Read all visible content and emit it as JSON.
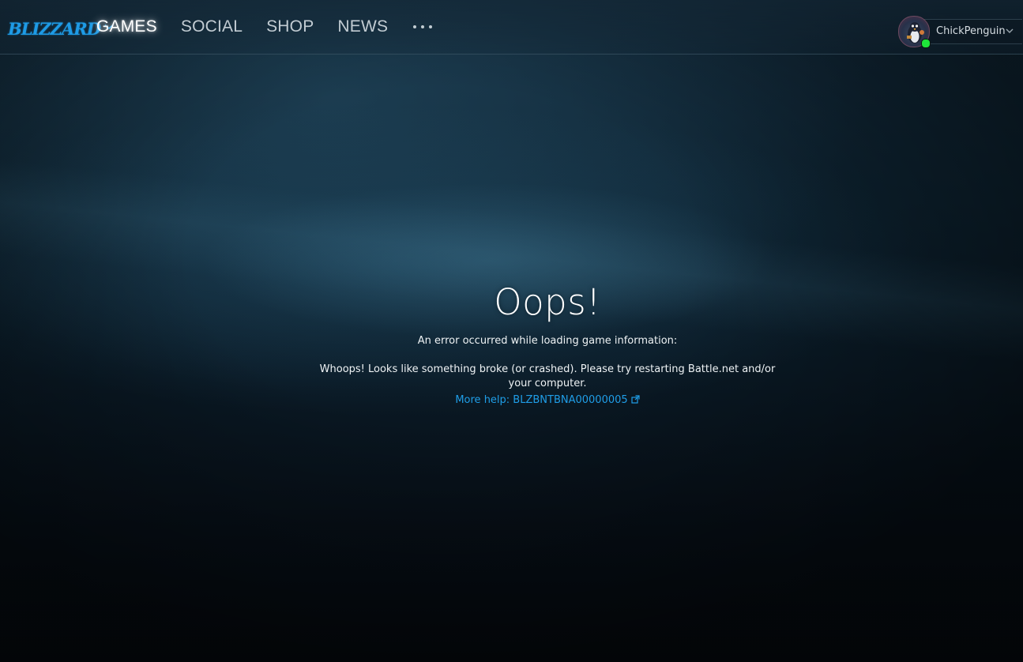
{
  "header": {
    "logo_text": "BLIZZARD",
    "nav": [
      {
        "label": "GAMES",
        "active": true
      },
      {
        "label": "SOCIAL",
        "active": false
      },
      {
        "label": "SHOP",
        "active": false
      },
      {
        "label": "NEWS",
        "active": false
      }
    ],
    "more_icon": "more-dots-icon"
  },
  "account": {
    "username": "ChickPenguin",
    "status": "online",
    "status_color": "#1ee63a"
  },
  "error": {
    "title": "Oops!",
    "subtitle": "An error occurred while loading game information:",
    "detail": "Whoops! Looks like something broke (or crashed). Please try restarting Battle.net and/or your computer.",
    "help_link": "More help: BLZBNTBNA00000005",
    "link_icon": "external-link-icon"
  },
  "colors": {
    "accent": "#1f9ee8",
    "logo": "#1e9be6",
    "text": "#ffffff",
    "nav_inactive": "#c2ccd3"
  }
}
